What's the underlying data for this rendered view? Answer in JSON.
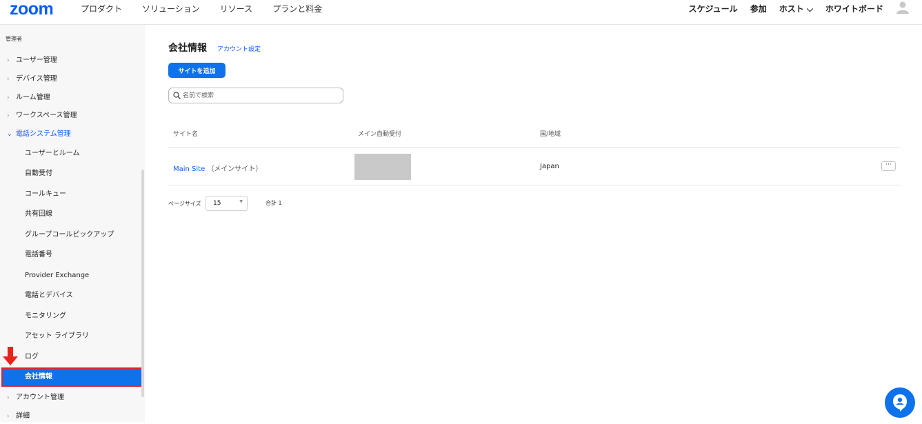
{
  "brand": {
    "logo": "zoom"
  },
  "nav": {
    "left": [
      "プロダクト",
      "ソリューション",
      "リソース",
      "プランと料金"
    ],
    "right": [
      "スケジュール",
      "参加",
      "ホスト ⌵",
      "ホワイトボード"
    ]
  },
  "sidebar": {
    "header": "管理者",
    "items": [
      {
        "label": "ユーザー管理"
      },
      {
        "label": "デバイス管理"
      },
      {
        "label": "ルーム管理"
      },
      {
        "label": "ワークスペース管理"
      },
      {
        "label": "電話システム管理"
      }
    ],
    "sub_items": [
      "ユーザーとルーム",
      "自動受付",
      "コールキュー",
      "共有回線",
      "グループコールピックアップ",
      "電話番号",
      "Provider Exchange",
      "電話とデバイス",
      "モニタリング",
      "アセット ライブラリ",
      "ログ"
    ],
    "active": "会社情報",
    "bottom_items": [
      {
        "label": "アカウント管理"
      },
      {
        "label": "詳細"
      }
    ]
  },
  "main": {
    "title": "会社情報",
    "title_link": "アカウント設定",
    "add_button": "サイトを追加",
    "search_placeholder": "名前で検索",
    "columns": [
      "サイト名",
      "メイン自動受付",
      "国/地域"
    ],
    "rows": [
      {
        "site": "Main Site",
        "suffix": "（メインサイト）",
        "country": "Japan"
      }
    ],
    "more_label": "···",
    "pager": {
      "label": "ページサイズ",
      "size": "15",
      "total": "合計 1"
    }
  },
  "colors": {
    "accent": "#0e72ed",
    "brand": "#0b5cff",
    "highlight": "#e0222b"
  }
}
